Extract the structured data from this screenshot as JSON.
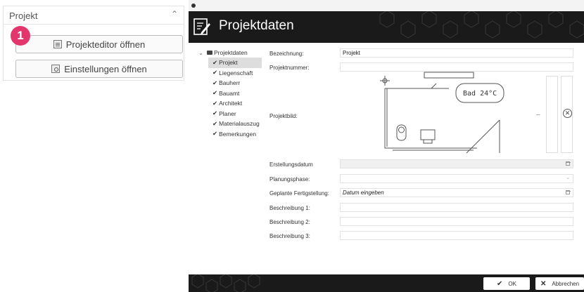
{
  "left_panel": {
    "title": "Projekt",
    "step_number": "1",
    "editor_button": "Projekteditor öffnen",
    "settings_button": "Einstellungen öffnen"
  },
  "dialog": {
    "title": "Projektdaten",
    "tree": {
      "root": "Projektdaten",
      "items": [
        "Projekt",
        "Liegenschaft",
        "Bauherr",
        "Bauamt",
        "Architekt",
        "Planer",
        "Materialauszug",
        "Bemerkungen"
      ],
      "selected": "Projekt"
    },
    "form": {
      "bezeichnung_label": "Bezeichnung:",
      "bezeichnung_value": "Projekt",
      "projektnummer_label": "Projektnummer:",
      "projektbild_label": "Projektbild:",
      "plan_text": "Bad 24°C",
      "erstellungsdatum_label": "Erstellungsdatum",
      "planungsphase_label": "Planungsphase:",
      "fertigstellung_label": "Geplante Fertigstellung:",
      "fertigstellung_placeholder": "Datum eingeben",
      "beschreibung1_label": "Beschreibung 1:",
      "beschreibung2_label": "Beschreibung 2:",
      "beschreibung3_label": "Beschreibung 3:"
    },
    "footer": {
      "ok_label": "OK",
      "cancel_label": "Abbrechen"
    }
  },
  "colors": {
    "badge": "#e3366c",
    "header_bg": "#1a1a1a"
  }
}
